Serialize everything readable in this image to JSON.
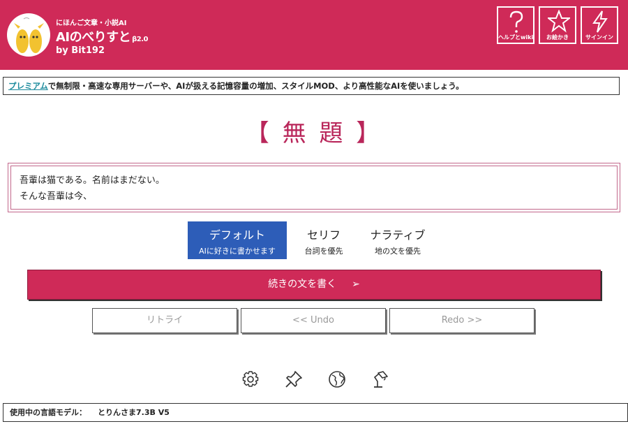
{
  "header": {
    "subtitle": "にほんご文章・小説AI",
    "title": "AIのべりすと",
    "beta": "β2.0",
    "by": "by Bit192",
    "buttons": [
      {
        "label": "ヘルプとwiki",
        "icon": "question-icon"
      },
      {
        "label": "お絵かき",
        "icon": "star-icon"
      },
      {
        "label": "サインイン",
        "icon": "lightning-icon"
      }
    ]
  },
  "banner": {
    "link": "プレミアム",
    "text": "で無制限・高速な専用サーバーや、AIが扱える記憶容量の増加、スタイルMOD、より高性能なAIを使いましょう。"
  },
  "document": {
    "title": "【 無 題 】",
    "lines": [
      "吾輩は猫である。名前はまだない。",
      "そんな吾輩は今、"
    ]
  },
  "modes": [
    {
      "title": "デフォルト",
      "desc": "AIに好きに書かせます",
      "active": true
    },
    {
      "title": "セリフ",
      "desc": "台詞を優先",
      "active": false
    },
    {
      "title": "ナラティブ",
      "desc": "地の文を優先",
      "active": false
    }
  ],
  "actions": {
    "continue_label": "続きの文を書く",
    "continue_arrow": "➢",
    "retry_label": "リトライ",
    "undo_label": "<< Undo",
    "redo_label": "Redo >>"
  },
  "tools": [
    "gear-icon",
    "pin-icon",
    "globe-icon",
    "lamp-icon"
  ],
  "footer": {
    "label": "使用中の言語モデル：",
    "value": "とりんさま7.3B V5"
  },
  "colors": {
    "brand": "#cf2a58",
    "mode_active": "#2d5db8",
    "title": "#b9265a",
    "link": "#1a8a9c"
  }
}
